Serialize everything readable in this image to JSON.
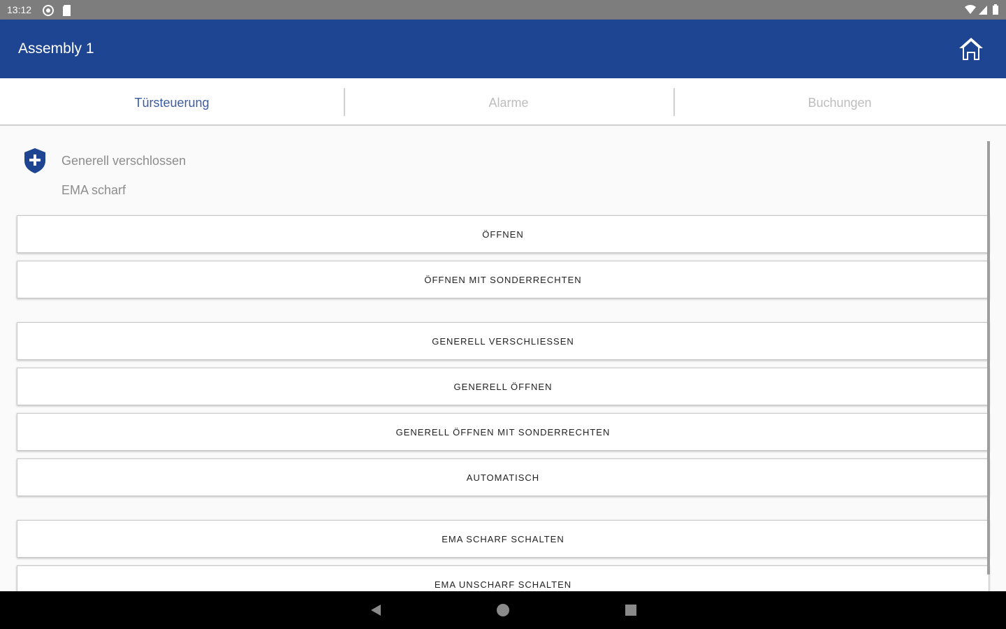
{
  "status_bar": {
    "time": "13:12",
    "icons": [
      "notification-icon",
      "sim-card-icon",
      "wifi-icon",
      "signal-icon",
      "battery-icon"
    ]
  },
  "app_bar": {
    "title": "Assembly 1",
    "home_icon": "home-icon",
    "background": "#1e4591"
  },
  "tabs": [
    {
      "label": "Türsteuerung",
      "active": true
    },
    {
      "label": "Alarme",
      "active": false
    },
    {
      "label": "Buchungen",
      "active": false
    }
  ],
  "door_status": {
    "icon": "shield-plus-icon",
    "lines": [
      "Generell verschlossen",
      "EMA scharf"
    ]
  },
  "buttons": [
    "ÖFFNEN",
    "ÖFFNEN MIT SONDERRECHTEN",
    "GENERELL VERSCHLIESSEN",
    "GENERELL ÖFFNEN",
    "GENERELL ÖFFNEN MIT SONDERRECHTEN",
    "AUTOMATISCH",
    "EMA SCHARF SCHALTEN",
    "EMA UNSCHARF SCHALTEN"
  ],
  "nav_bar": {
    "icons": [
      "back-icon",
      "home-circle-icon",
      "recents-icon"
    ]
  },
  "colors": {
    "accent": "#1e4591",
    "active_tab": "#3a5ca6",
    "inactive_tab": "#bdbdbd"
  }
}
